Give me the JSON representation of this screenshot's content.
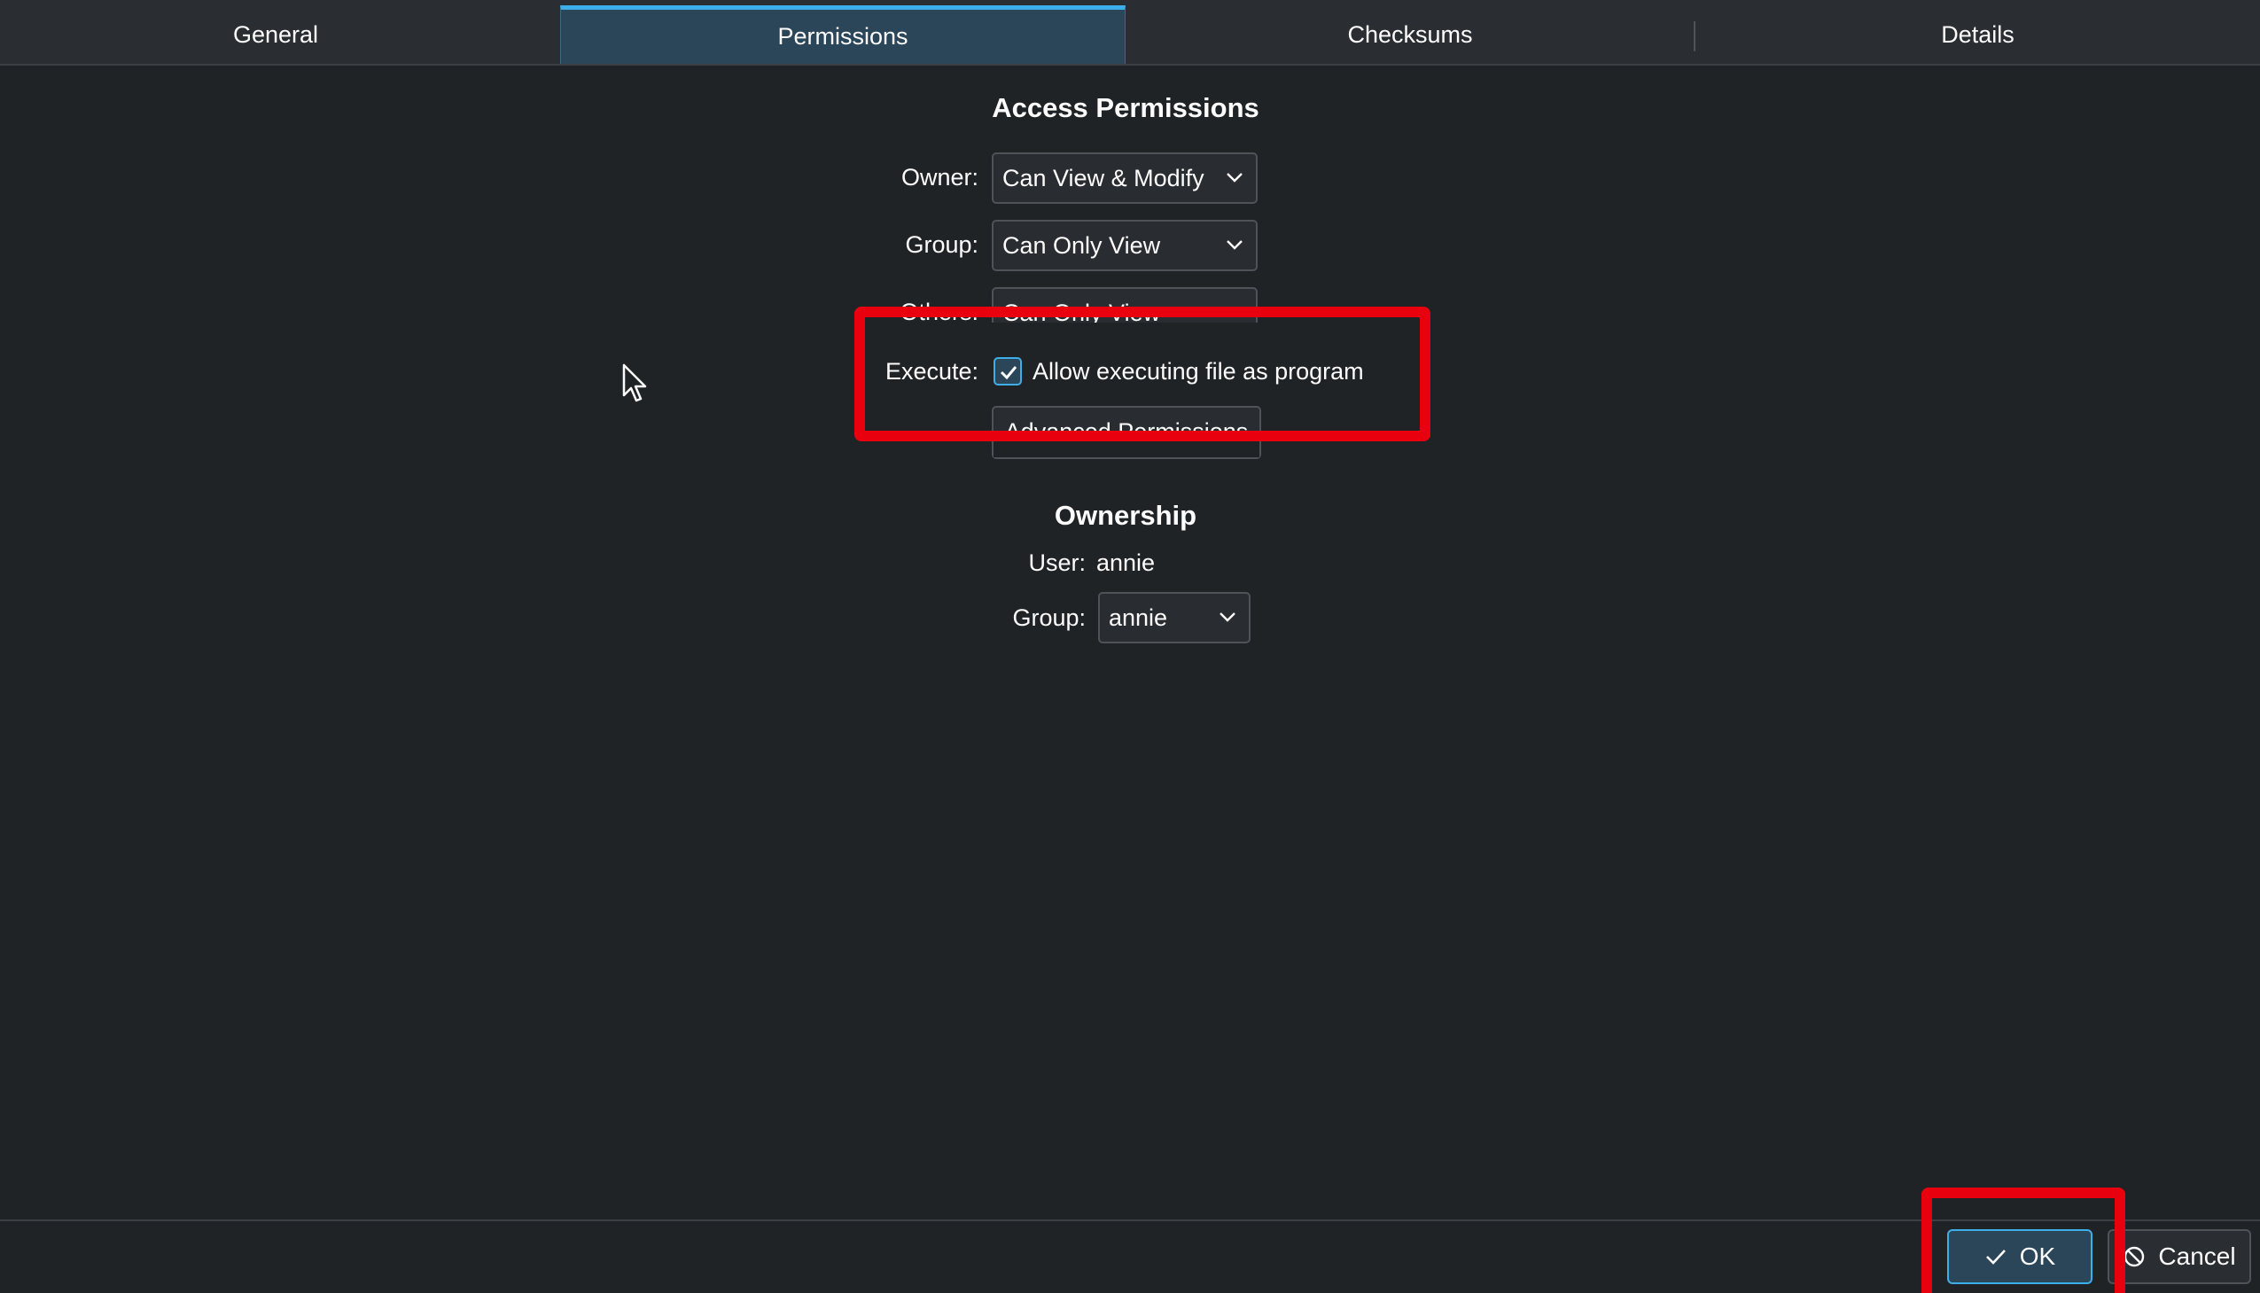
{
  "tabs": [
    {
      "label": "General",
      "active": false
    },
    {
      "label": "Permissions",
      "active": true
    },
    {
      "label": "Checksums",
      "active": false
    },
    {
      "label": "Details",
      "active": false
    }
  ],
  "access": {
    "title": "Access Permissions",
    "owner_label": "Owner:",
    "owner_value": "Can View & Modify",
    "group_label": "Group:",
    "group_value": "Can Only View",
    "others_label": "Others:",
    "others_value": "Can Only View",
    "execute_label": "Execute:",
    "execute_checked": true,
    "execute_text": "Allow executing file as program",
    "advanced_label": "Advanced Permissions"
  },
  "ownership": {
    "title": "Ownership",
    "user_label": "User:",
    "user_value": "annie",
    "group_label": "Group:",
    "group_value": "annie"
  },
  "buttons": {
    "ok": "OK",
    "cancel": "Cancel"
  },
  "colors": {
    "accent": "#3daee9",
    "highlight": "#e8000f",
    "background": "#202326"
  }
}
